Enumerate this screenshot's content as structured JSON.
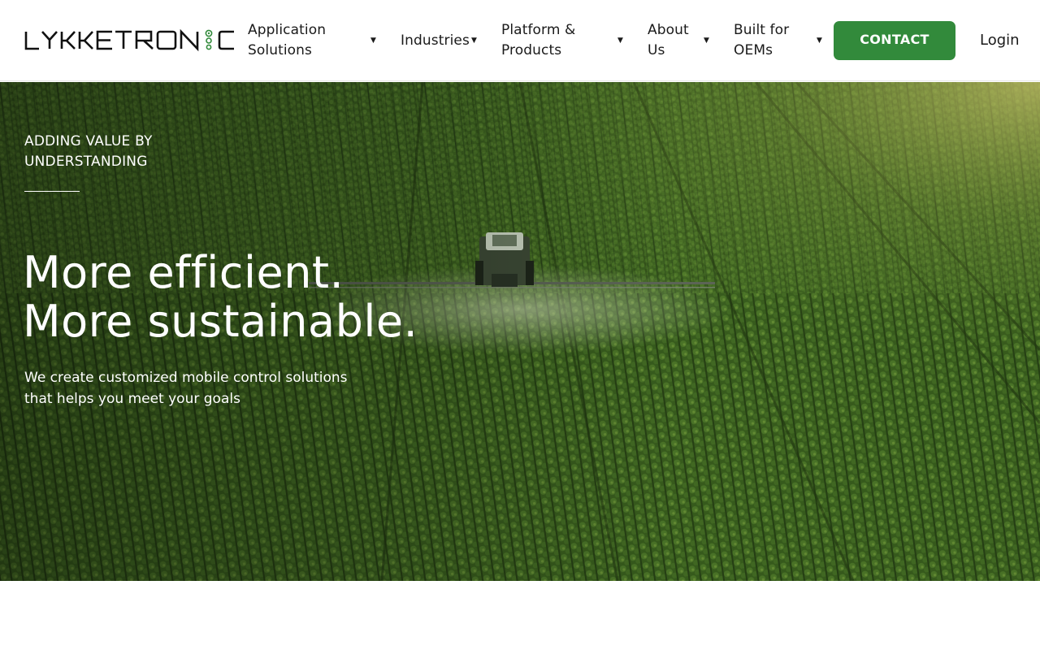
{
  "brand": {
    "name": "LYKKETRONIC",
    "accent_color": "#328a3b"
  },
  "nav": {
    "items": [
      {
        "label": "Application Solutions",
        "has_dropdown": true,
        "icon": "caret-down-icon"
      },
      {
        "label": "Industries",
        "has_dropdown": true,
        "icon": "caret-down-icon"
      },
      {
        "label": "Platform & Products",
        "has_dropdown": true,
        "icon": "caret-down-icon"
      },
      {
        "label": "About Us",
        "has_dropdown": true,
        "icon": "caret-down-icon"
      },
      {
        "label": "Built for OEMs",
        "has_dropdown": true,
        "icon": "caret-down-icon"
      }
    ],
    "contact_label": "CONTACT",
    "login_label": "Login"
  },
  "hero": {
    "eyebrow": "ADDING VALUE BY UNDERSTANDING",
    "headline_line1": "More efficient.",
    "headline_line2": "More sustainable.",
    "subtext": "We create customized mobile control solutions that helps you meet your goals",
    "background": "aerial photo of tractor spraying crop field"
  }
}
